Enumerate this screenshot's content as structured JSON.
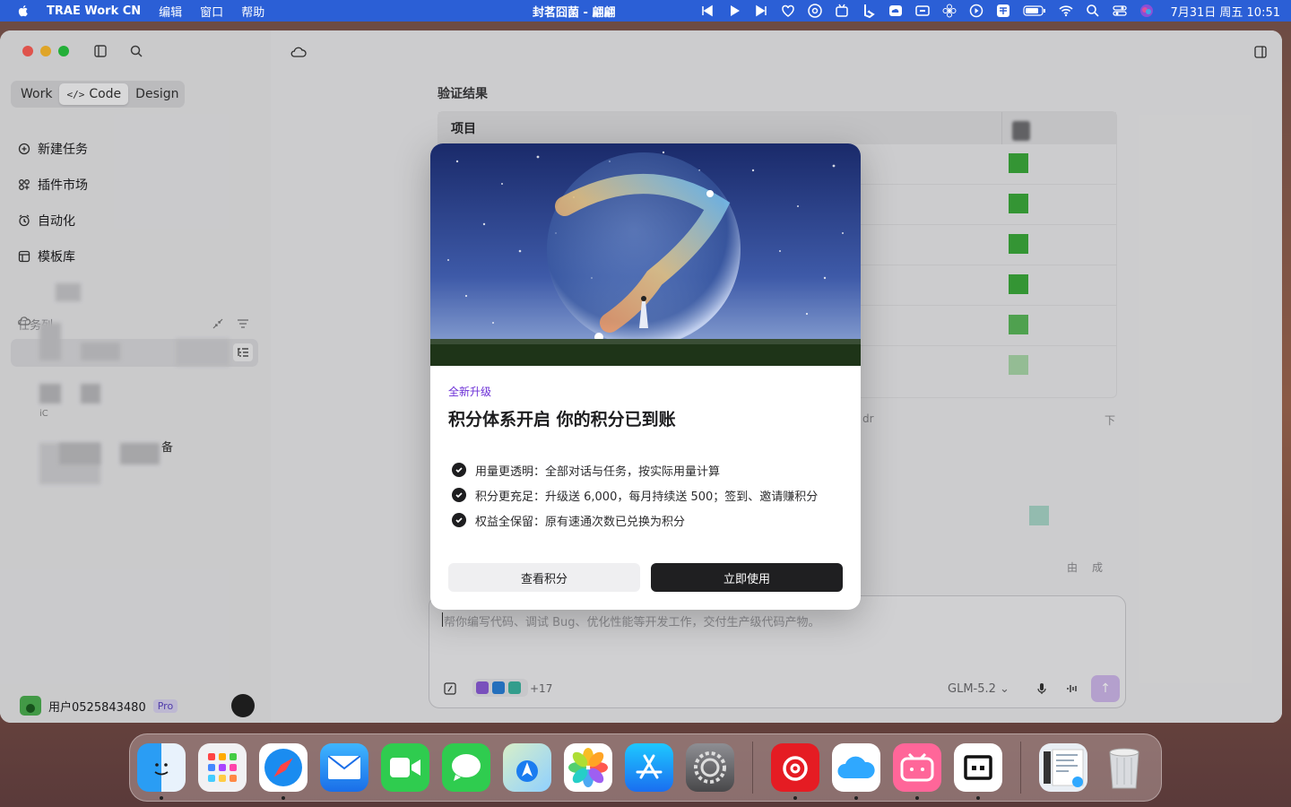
{
  "menubar": {
    "app_name": "TRAE Work CN",
    "menus": [
      "编辑",
      "窗口",
      "帮助"
    ],
    "now_playing": "封茗囧菌 - 翩翩",
    "clock": "7月31日 周五 10:51"
  },
  "sidebar": {
    "mode_tabs": [
      "Work",
      "Code",
      "Design"
    ],
    "active_tab": "Code",
    "nav": [
      {
        "label": "新建任务",
        "icon": "new-task-icon"
      },
      {
        "label": "插件市场",
        "icon": "plugin-icon"
      },
      {
        "label": "自动化",
        "icon": "clock-icon"
      },
      {
        "label": "模板库",
        "icon": "template-icon"
      }
    ],
    "section_label": "任务列",
    "partial_text_1": "iC",
    "partial_text_2": "备",
    "footer": {
      "user": "用户0525843480",
      "badge": "Pro"
    }
  },
  "main": {
    "result_title": "验证结果",
    "table_header": "项目",
    "ghost_texts": [
      "dr",
      "下",
      "由",
      "成"
    ],
    "composer": {
      "placeholder": "帮你编写代码、调试 Bug、优化性能等开发工作，交付生产级代码产物。",
      "plugin_count": "+17",
      "model": "GLM-5.2"
    }
  },
  "modal": {
    "eyebrow": "全新升级",
    "title": "积分体系开启 你的积分已到账",
    "features": [
      "用量更透明：全部对话与任务，按实际用量计算",
      "积分更充足：升级送 6,000，每月持续送 500；签到、邀请赚积分",
      "权益全保留：原有速通次数已兑换为积分"
    ],
    "secondary_button": "查看积分",
    "primary_button": "立即使用"
  },
  "dock": {
    "apps": [
      "Finder",
      "Launchpad",
      "Safari",
      "Mail",
      "FaceTime",
      "Messages",
      "Maps",
      "Photos",
      "App Store",
      "System Settings",
      "NetEase Music",
      "Baidu Netdisk",
      "bilibili",
      "TRAE",
      "Preview",
      "Trash"
    ]
  },
  "colors": {
    "menubar": "#2b5fd6",
    "accent_purple": "#6b2ed6",
    "primary_button": "#1f1f21"
  }
}
